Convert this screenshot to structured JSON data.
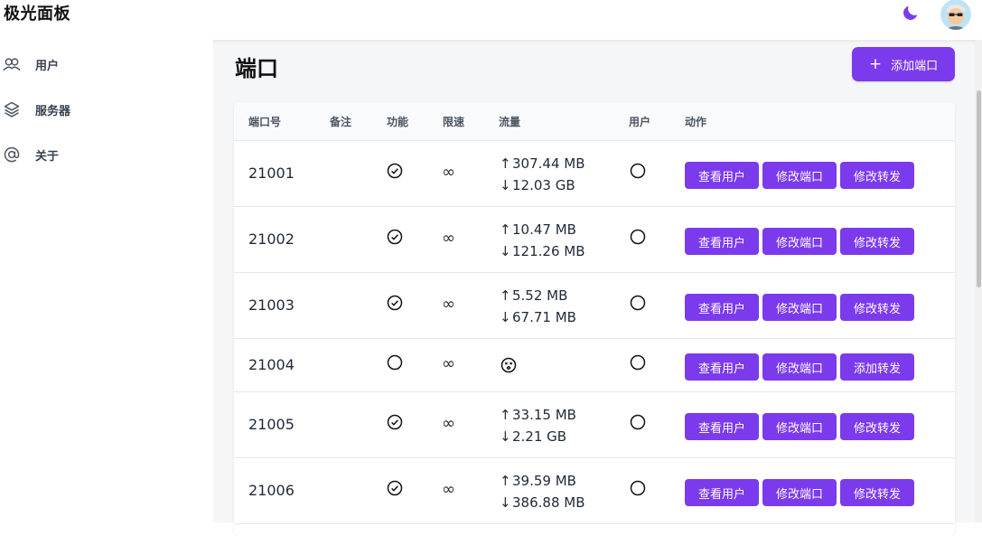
{
  "app": {
    "title": "极光面板"
  },
  "sidebar": {
    "items": [
      {
        "label": "用户",
        "icon": "users-icon"
      },
      {
        "label": "服务器",
        "icon": "layers-icon"
      },
      {
        "label": "关于",
        "icon": "at-sign-icon"
      }
    ]
  },
  "main": {
    "title": "端口",
    "add_button": "添加端口",
    "table": {
      "headers": [
        "端口号",
        "备注",
        "功能",
        "限速",
        "流量",
        "用户",
        "动作"
      ],
      "rows": [
        {
          "port": "21001",
          "note": "",
          "function": "check-circle",
          "limit": "∞",
          "up": "307.44 MB",
          "down": "12.03 GB",
          "user": "empty-circle",
          "actions": [
            "查看用户",
            "修改端口",
            "修改转发"
          ]
        },
        {
          "port": "21002",
          "note": "",
          "function": "check-circle",
          "limit": "∞",
          "up": "10.47 MB",
          "down": "121.26 MB",
          "user": "empty-circle",
          "actions": [
            "查看用户",
            "修改端口",
            "修改转发"
          ]
        },
        {
          "port": "21003",
          "note": "",
          "function": "check-circle",
          "limit": "∞",
          "up": "5.52 MB",
          "down": "67.71 MB",
          "user": "empty-circle",
          "actions": [
            "查看用户",
            "修改端口",
            "修改转发"
          ]
        },
        {
          "port": "21004",
          "note": "",
          "function": "empty-circle",
          "limit": "∞",
          "up": "",
          "down": "",
          "traffic_icon": "dizzy-face-icon",
          "user": "empty-circle",
          "actions": [
            "查看用户",
            "修改端口",
            "添加转发"
          ]
        },
        {
          "port": "21005",
          "note": "",
          "function": "check-circle",
          "limit": "∞",
          "up": "33.15 MB",
          "down": "2.21 GB",
          "user": "empty-circle",
          "actions": [
            "查看用户",
            "修改端口",
            "修改转发"
          ]
        },
        {
          "port": "21006",
          "note": "",
          "function": "check-circle",
          "limit": "∞",
          "up": "39.59 MB",
          "down": "386.88 MB",
          "user": "empty-circle",
          "actions": [
            "查看用户",
            "修改端口",
            "修改转发"
          ]
        }
      ]
    }
  },
  "colors": {
    "accent": "#7c3aed",
    "moon": "#7c3aed",
    "background": "#f5f6f8"
  }
}
